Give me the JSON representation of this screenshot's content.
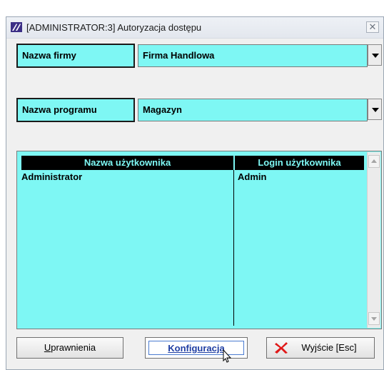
{
  "window": {
    "title": "[ADMINISTRATOR:3]  Autoryzacja dostępu",
    "close_glyph": "✕"
  },
  "company": {
    "label": "Nazwa firmy",
    "value": "Firma Handlowa"
  },
  "program": {
    "label": "Nazwa programu",
    "value": "Magazyn"
  },
  "users_table": {
    "columns": [
      "Nazwa użytkownika",
      "Login użytkownika"
    ],
    "rows": [
      [
        "Administrator",
        "Admin"
      ]
    ]
  },
  "buttons": {
    "permissions": {
      "label_prefix": "",
      "underlined": "U",
      "rest": "prawnienia"
    },
    "config": {
      "underlined_text": "Konfiguracja"
    },
    "exit": {
      "label": "Wyjście  [Esc]",
      "icon": "red-x-icon"
    }
  },
  "colors": {
    "field_bg": "#7ef7f4",
    "header_bg": "#000000",
    "exit_icon": "#e01818"
  }
}
